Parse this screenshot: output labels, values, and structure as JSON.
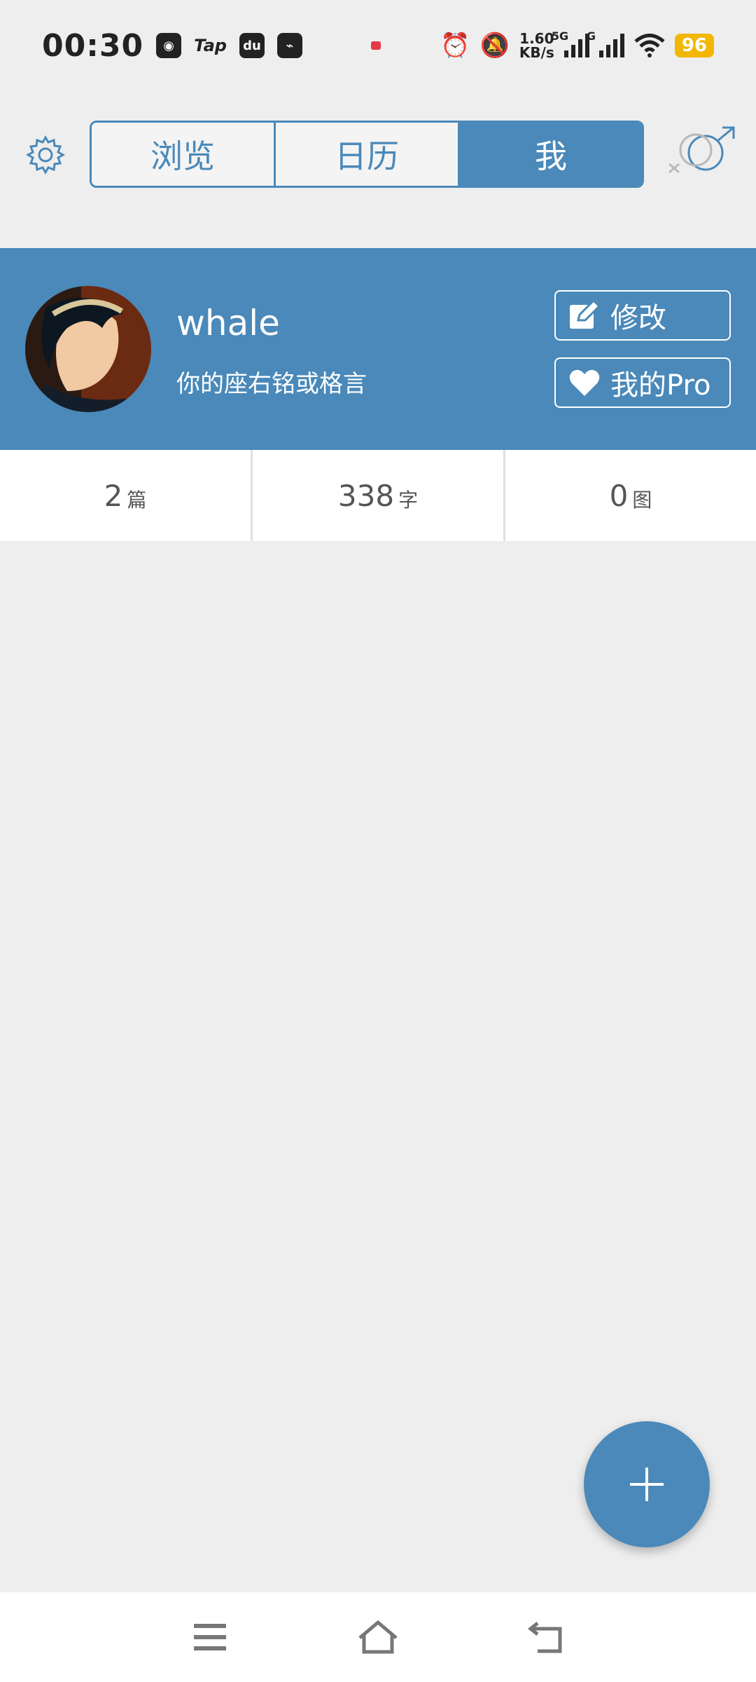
{
  "status_bar": {
    "time": "00:30",
    "apps": [
      "Tap",
      "du"
    ],
    "netspeed_value": "1.60",
    "netspeed_unit": "KB/s",
    "network_5g": "5G",
    "network_g": "G",
    "battery": "96",
    "icons": [
      "alarm-icon",
      "mute-icon",
      "signal-icon",
      "wifi-icon"
    ]
  },
  "header": {
    "tabs": [
      {
        "label": "浏览",
        "active": false
      },
      {
        "label": "日历",
        "active": false
      },
      {
        "label": "我",
        "active": true
      }
    ],
    "icons": {
      "settings": "gear-icon",
      "gender": "gender-icon"
    }
  },
  "profile": {
    "username": "whale",
    "motto": "你的座右铭或格言",
    "edit_label": "修改",
    "pro_label": "我的Pro"
  },
  "stats": [
    {
      "value": "2",
      "unit": "篇"
    },
    {
      "value": "338",
      "unit": "字"
    },
    {
      "value": "0",
      "unit": "图"
    }
  ],
  "colors": {
    "accent": "#4a89b9",
    "background": "#eeeeee",
    "battery": "#f2b705"
  }
}
